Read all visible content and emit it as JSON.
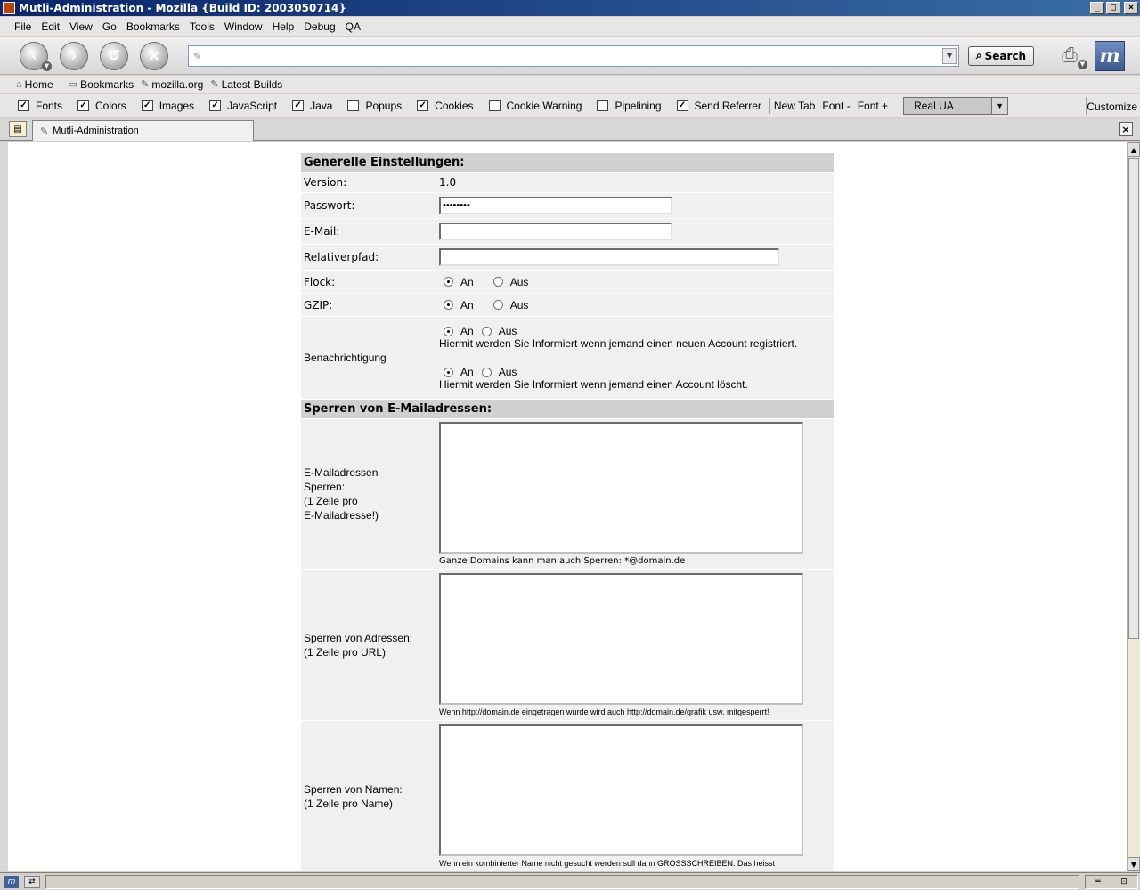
{
  "window": {
    "title": "Mutli-Administration - Mozilla {Build ID: 2003050714}",
    "buttons": {
      "minimize": "_",
      "maximize": "□",
      "close": "×"
    }
  },
  "menu": [
    "File",
    "Edit",
    "View",
    "Go",
    "Bookmarks",
    "Tools",
    "Window",
    "Help",
    "Debug",
    "QA"
  ],
  "navbar": {
    "url_value": "",
    "search_label": "Search"
  },
  "personal_toolbar": [
    "Home",
    "Bookmarks",
    "mozilla.org",
    "Latest Builds"
  ],
  "prefbar": {
    "checkboxes": [
      {
        "label": "Fonts",
        "checked": true
      },
      {
        "label": "Colors",
        "checked": true
      },
      {
        "label": "Images",
        "checked": true
      },
      {
        "label": "JavaScript",
        "checked": true
      },
      {
        "label": "Java",
        "checked": true
      },
      {
        "label": "Popups",
        "checked": false
      },
      {
        "label": "Cookies",
        "checked": true
      },
      {
        "label": "Cookie Warning",
        "checked": false
      },
      {
        "label": "Pipelining",
        "checked": false
      },
      {
        "label": "Send Referrer",
        "checked": true
      }
    ],
    "new_tab": "New Tab",
    "font_minus": "Font -",
    "font_plus": "Font +",
    "ua_selected": "Real UA",
    "customize": "Customize"
  },
  "tab": {
    "title": "Mutli-Administration"
  },
  "form": {
    "section1_title": "Generelle Einstellungen:",
    "version_label": "Version:",
    "version_value": "1.0",
    "password_label": "Passwort:",
    "password_value": "********",
    "email_label": "E-Mail:",
    "email_value": "",
    "relpath_label": "Relativerpfad:",
    "relpath_value": "",
    "flock_label": "Flock:",
    "gzip_label": "GZIP:",
    "on_label": "An",
    "off_label": "Aus",
    "notify_label": "Benachrichtigung",
    "notify_text1": "Hiermit werden Sie Informiert wenn jemand einen neuen Account registriert.",
    "notify_text2": "Hiermit werden Sie Informiert wenn jemand einen Account löscht.",
    "section2_title": "Sperren von E-Mailadressen:",
    "block_email_label_1": "E-Mailadressen",
    "block_email_label_2": "Sperren:",
    "block_email_label_3": "(1 Zeile pro",
    "block_email_label_4": "E-Mailadresse!)",
    "block_email_hint": "Ganze Domains kann man auch Sperren: *@domain.de",
    "block_addr_label_1": "Sperren von Adressen:",
    "block_addr_label_2": "(1 Zeile pro URL)",
    "block_addr_hint": "Wenn http://domain.de eingetragen wurde wird auch http://domain.de/grafik usw. mitgesperrt!",
    "block_name_label_1": "Sperren von Namen:",
    "block_name_label_2": "(1 Zeile pro Name)",
    "block_name_hint": "Wenn ein kombinierter Name nicht gesucht werden soll dann GROSSSCHREIBEN. Das heisst"
  }
}
